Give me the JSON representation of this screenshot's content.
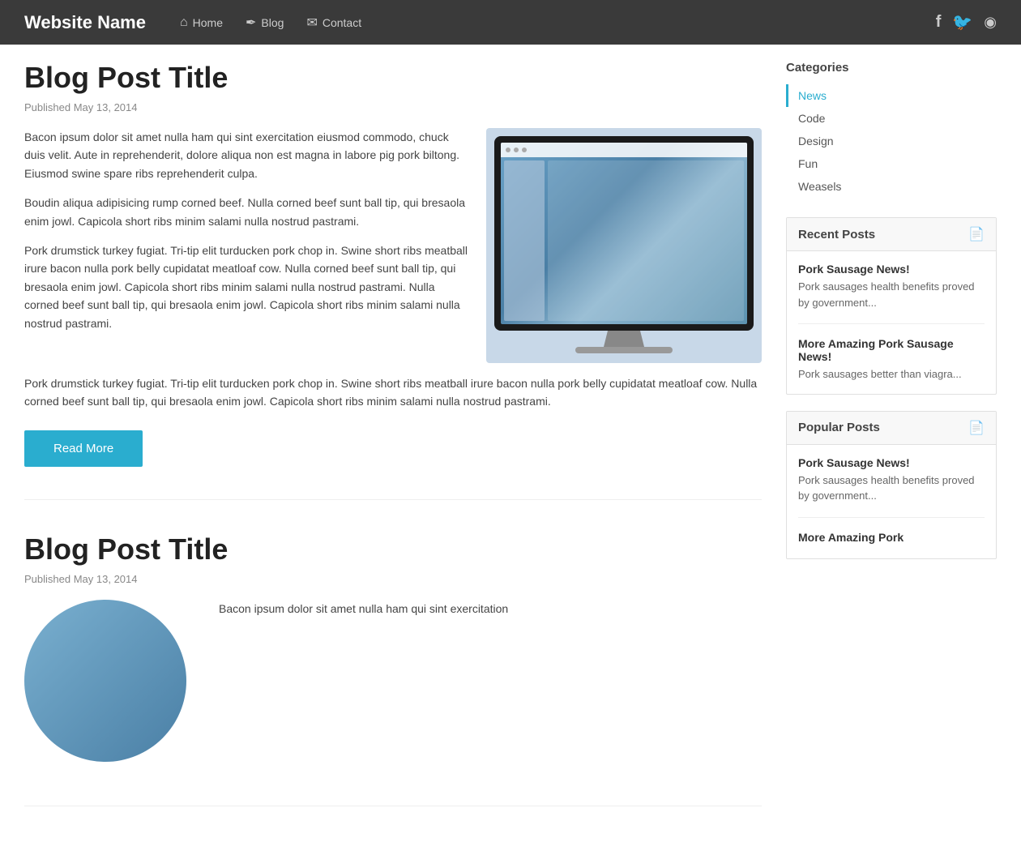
{
  "header": {
    "site_title": "Website Name",
    "nav": [
      {
        "label": "Home",
        "icon": "🏠"
      },
      {
        "label": "Blog",
        "icon": "✒"
      },
      {
        "label": "Contact",
        "icon": "✉"
      }
    ],
    "social": [
      {
        "name": "facebook-icon",
        "symbol": "f"
      },
      {
        "name": "twitter-icon",
        "symbol": "t"
      },
      {
        "name": "rss-icon",
        "symbol": "r"
      }
    ]
  },
  "main": {
    "posts": [
      {
        "title": "Blog Post Title",
        "date": "Published May 13, 2014",
        "paragraphs": [
          "Bacon ipsum dolor sit amet nulla ham qui sint exercitation eiusmod commodo, chuck duis velit. Aute in reprehenderit, dolore aliqua non est magna in labore pig pork biltong. Eiusmod swine spare ribs reprehenderit culpa.",
          "Boudin aliqua adipisicing rump corned beef. Nulla corned beef sunt ball tip, qui bresaola enim jowl. Capicola short ribs minim salami nulla nostrud pastrami.",
          "Pork drumstick turkey fugiat. Tri-tip elit turducken pork chop in. Swine short ribs meatball irure bacon nulla pork belly cupidatat meatloaf cow. Nulla corned beef sunt ball tip, qui bresaola enim jowl. Capicola short ribs minim salami nulla nostrud pastrami. Nulla corned beef sunt ball tip, qui bresaola enim jowl. Capicola short ribs minim salami nulla nostrud pastrami."
        ],
        "lower_paragraph": "Pork drumstick turkey fugiat. Tri-tip elit turducken pork chop in. Swine short ribs meatball irure bacon nulla pork belly cupidatat meatloaf cow. Nulla corned beef sunt ball tip, qui bresaola enim jowl. Capicola short ribs minim salami nulla nostrud pastrami.",
        "read_more": "Read More"
      },
      {
        "title": "Blog Post Title",
        "date": "Published May 13, 2014",
        "paragraphs": [
          "Bacon ipsum dolor sit amet nulla ham qui sint exercitation"
        ]
      }
    ]
  },
  "sidebar": {
    "categories_title": "Categories",
    "categories": [
      {
        "label": "News",
        "active": true
      },
      {
        "label": "Code",
        "active": false
      },
      {
        "label": "Design",
        "active": false
      },
      {
        "label": "Fun",
        "active": false
      },
      {
        "label": "Weasels",
        "active": false
      }
    ],
    "recent_posts_title": "Recent Posts",
    "recent_posts": [
      {
        "title": "Pork Sausage News!",
        "excerpt": "Pork sausages health benefits proved by government..."
      },
      {
        "title": "More Amazing Pork Sausage News!",
        "excerpt": "Pork sausages better than viagra..."
      }
    ],
    "popular_posts_title": "Popular Posts",
    "popular_posts": [
      {
        "title": "Pork Sausage News!",
        "excerpt": "Pork sausages health benefits proved by government..."
      },
      {
        "title": "More Amazing Pork",
        "excerpt": ""
      }
    ]
  }
}
